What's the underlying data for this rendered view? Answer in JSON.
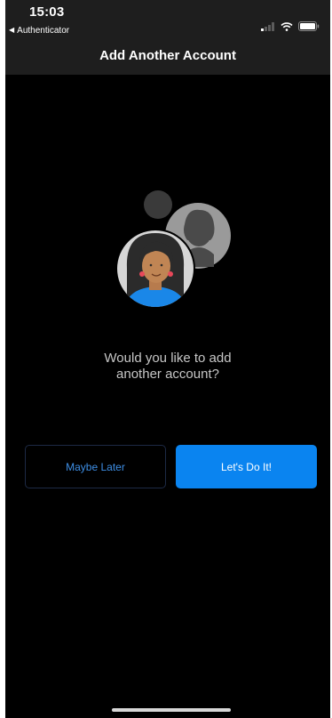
{
  "status_bar": {
    "time": "15:03",
    "back_app_label": "Authenticator",
    "icons": [
      "signal-icon",
      "wifi-icon",
      "battery-icon"
    ]
  },
  "nav": {
    "title": "Add Another Account"
  },
  "content": {
    "illustration": "add-account-illustration",
    "question": "Would you like to add\nanother account?"
  },
  "buttons": {
    "maybe_later": "Maybe Later",
    "lets_do_it": "Let's Do It!"
  },
  "colors": {
    "background": "#000000",
    "top_bar": "#1e1e1e",
    "accent": "#0a84f0",
    "secondary_text": "#3e8fe6"
  }
}
